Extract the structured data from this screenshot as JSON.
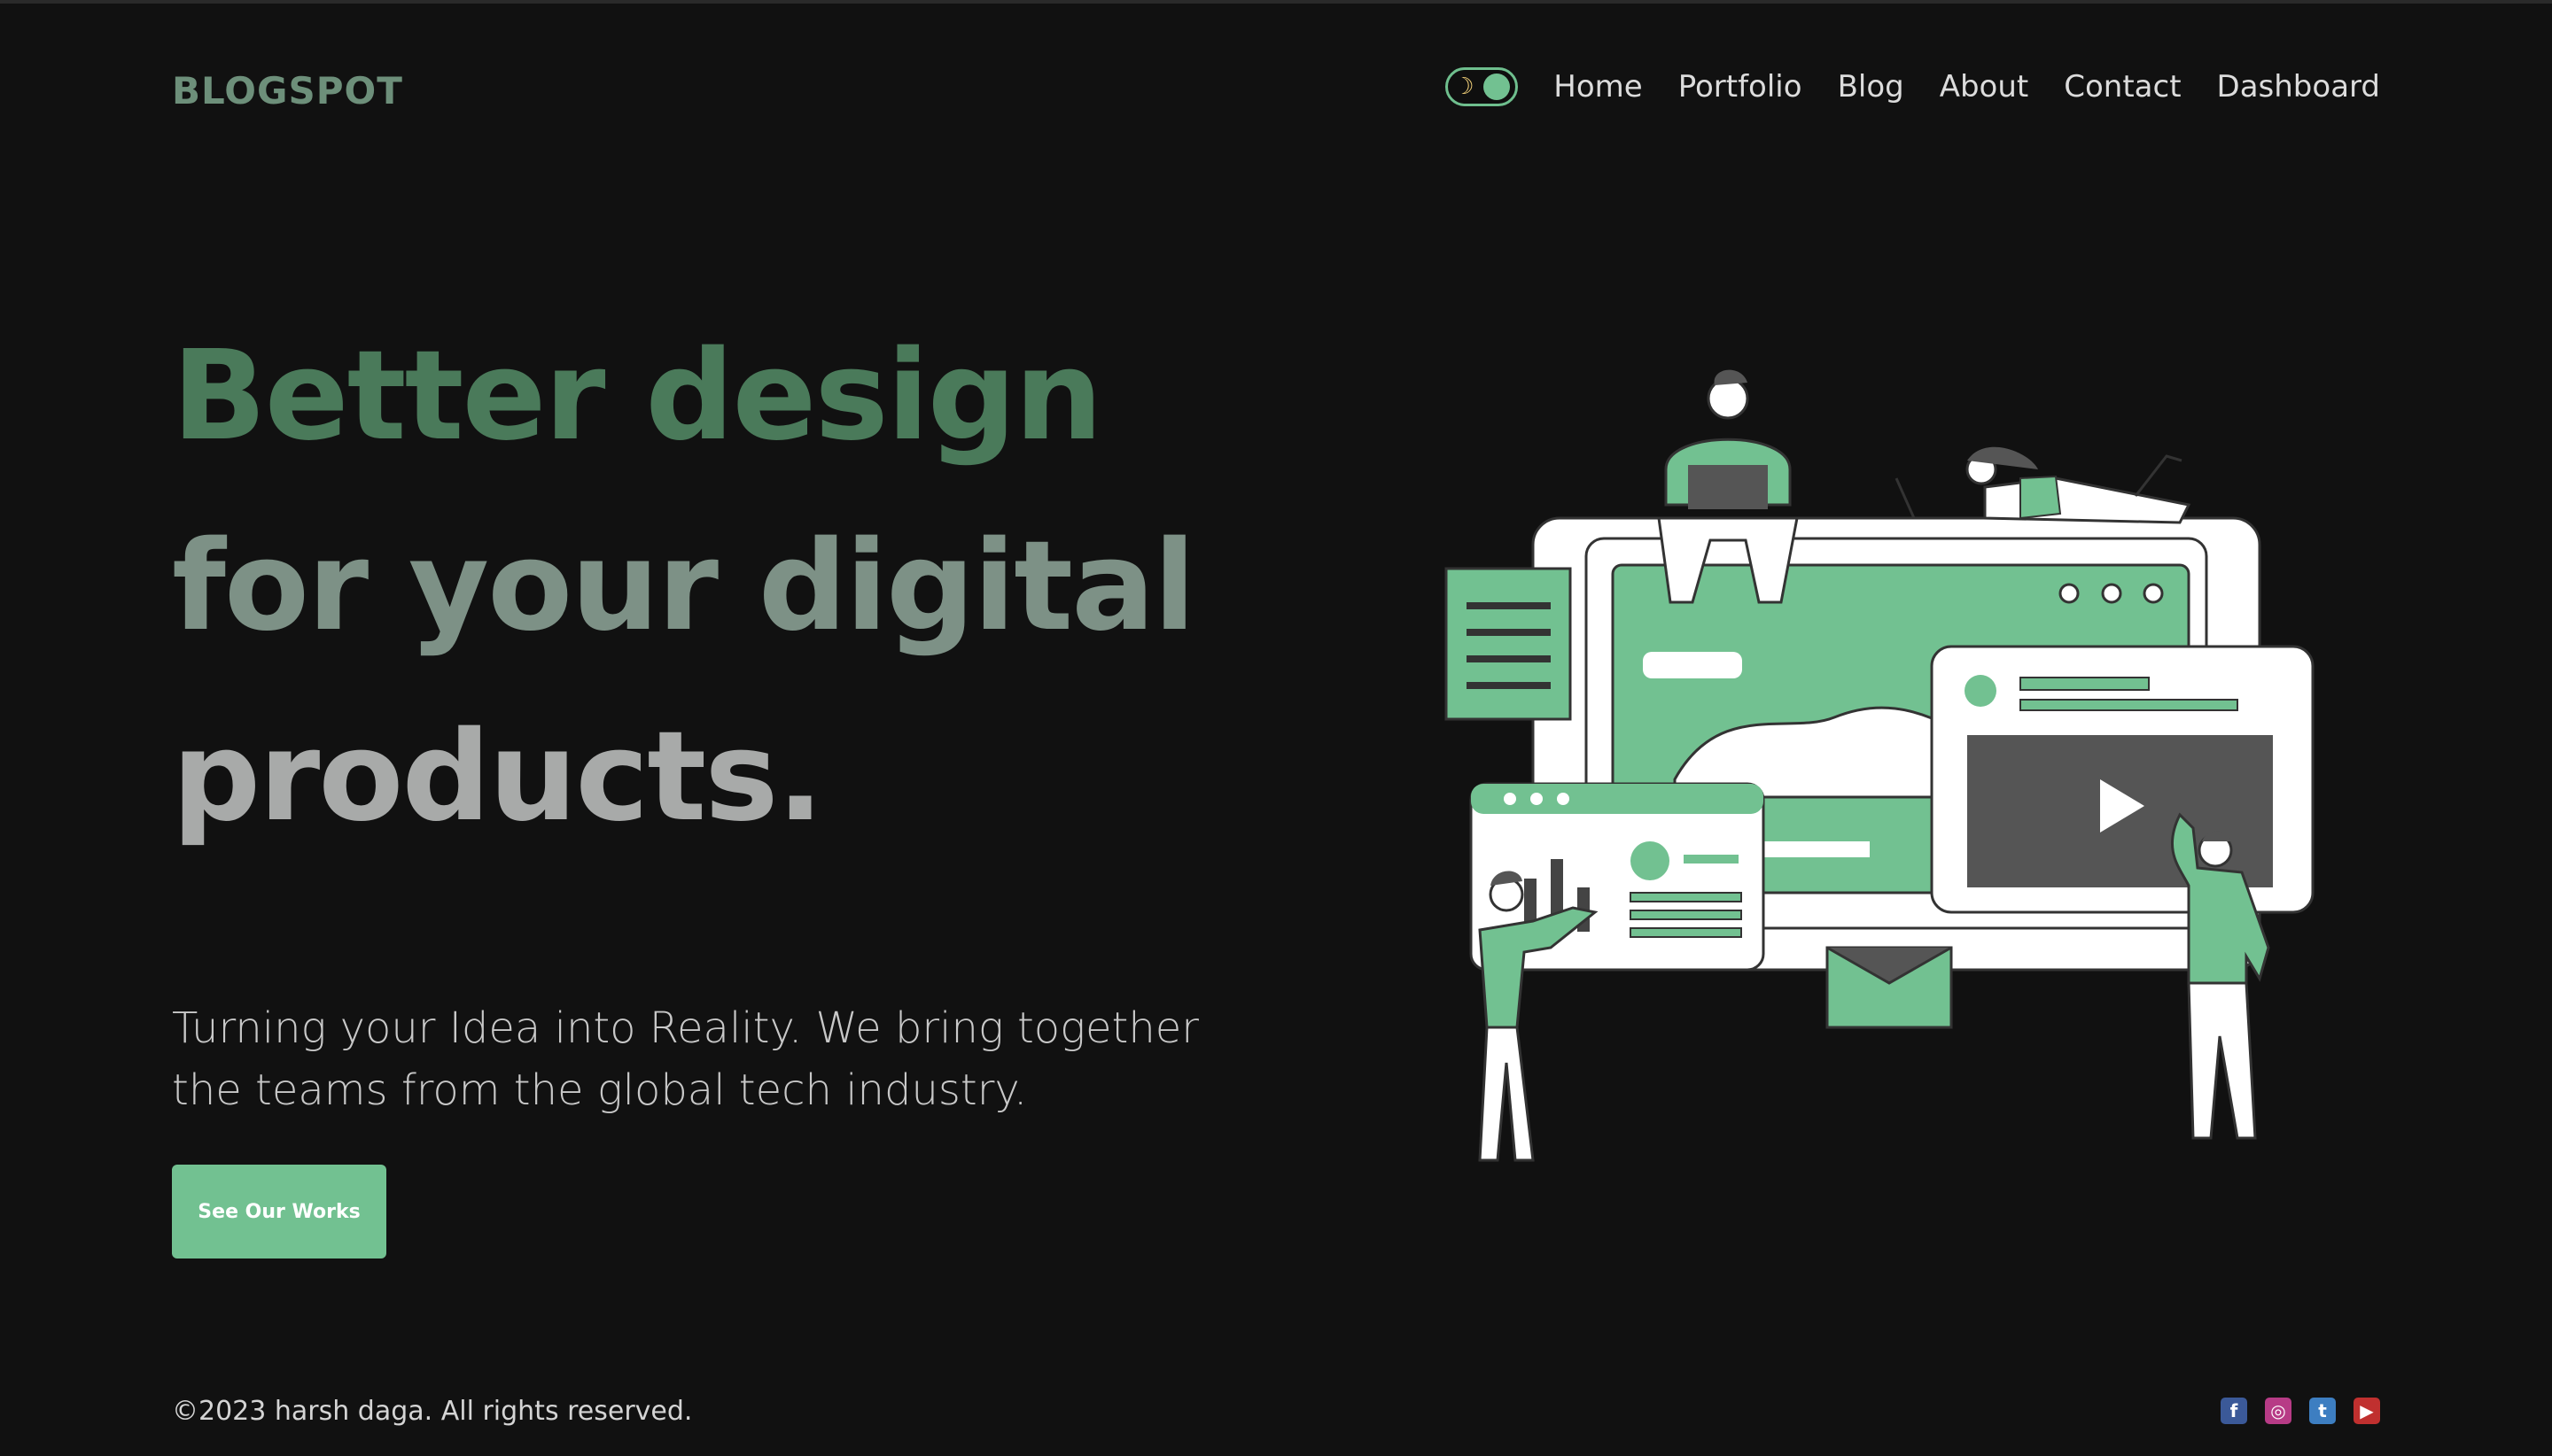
{
  "brand": {
    "logo": "BLOGSPOT"
  },
  "nav": {
    "theme_toggle_icon": "moon-icon",
    "items": [
      {
        "label": "Home"
      },
      {
        "label": "Portfolio"
      },
      {
        "label": "Blog"
      },
      {
        "label": "About"
      },
      {
        "label": "Contact"
      },
      {
        "label": "Dashboard"
      }
    ]
  },
  "hero": {
    "title_line1": "Better design",
    "title_line2": "for your digital",
    "title_line3": "products.",
    "subtitle": "Turning your Idea into Reality. We bring together the teams from the global tech industry.",
    "cta_label": "See Our Works"
  },
  "footer": {
    "copyright": "©2023 harsh daga. All rights reserved.",
    "socials": [
      "facebook-icon",
      "instagram-icon",
      "twitter-icon",
      "youtube-icon"
    ]
  },
  "colors": {
    "background": "#111111",
    "accent": "#72c191",
    "logo": "#6d8f7a"
  }
}
